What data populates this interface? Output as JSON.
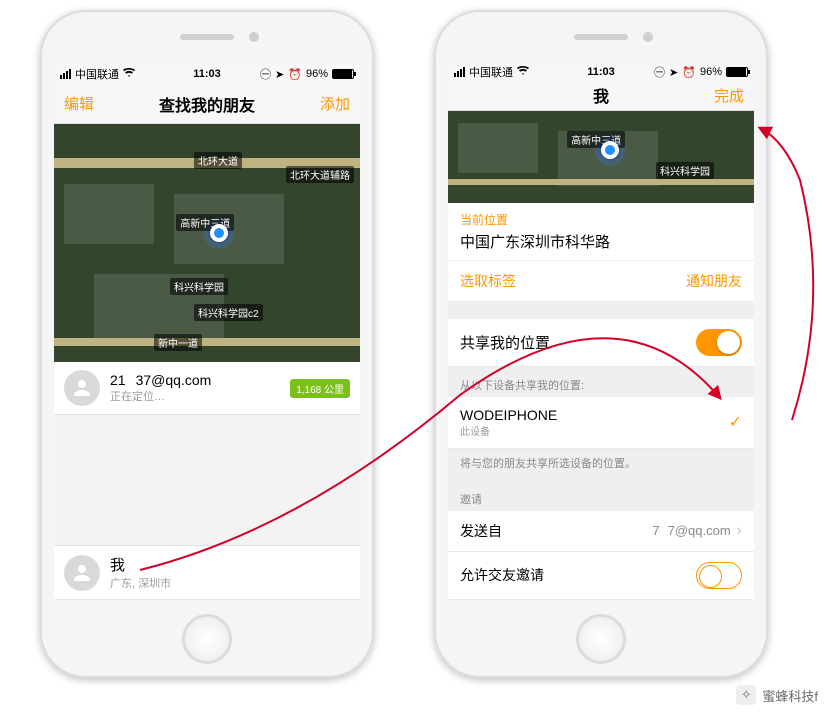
{
  "status": {
    "carrier": "中国联通",
    "time": "11:03",
    "battery_pct": "96%"
  },
  "left": {
    "nav": {
      "left": "编辑",
      "title": "查找我的朋友",
      "right": "添加"
    },
    "map": {
      "roads": [
        "北环大道",
        "北环大道辅路",
        "科兴科学园",
        "科兴科学园c2",
        "新中一道"
      ],
      "pin_label": "高新中三道"
    },
    "friend": {
      "name_prefix": "21",
      "name_suffix": "37@qq.com",
      "status": "正在定位…",
      "distance_badge": "1,168 公里"
    },
    "me": {
      "label": "我",
      "sub": "广东, 深圳市"
    }
  },
  "right": {
    "nav": {
      "title": "我",
      "right": "完成"
    },
    "map": {
      "road": "科兴科学园",
      "pin_label": "高新中三道"
    },
    "current_location": {
      "label": "当前位置",
      "value": "中国广东深圳市科华路"
    },
    "tags": {
      "select": "选取标签",
      "notify": "通知朋友"
    },
    "share": {
      "label": "共享我的位置",
      "on": true
    },
    "device_group": {
      "header": "从以下设备共享我的位置:",
      "name": "WODEIPHONE",
      "sub": "此设备",
      "footer": "将与您的朋友共享所选设备的位置。"
    },
    "invite": {
      "header": "邀请",
      "from_label": "发送自",
      "from_value_prefix": "7",
      "from_value_suffix": "7@qq.com",
      "allow_label": "允许交友邀请",
      "allow_on": false
    }
  },
  "watermark": "蜜蜂科技f"
}
